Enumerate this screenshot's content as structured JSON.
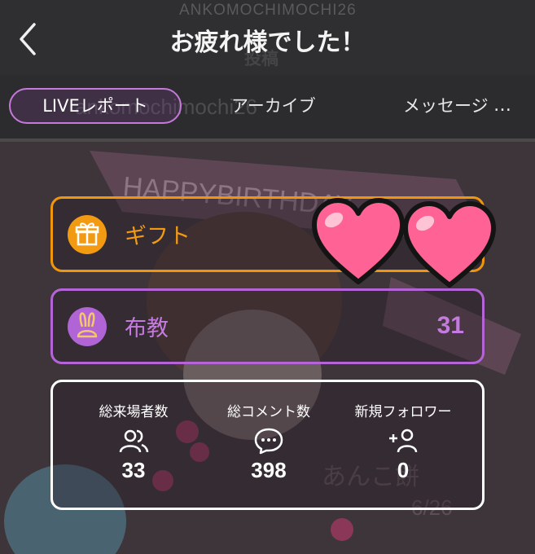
{
  "header": {
    "title": "お疲れ様でした！",
    "ghost_name": "ANKOMOCHIMOCHI26",
    "ghost_subtitle": "投稿",
    "back_icon": "chevron-left-icon"
  },
  "tabs": {
    "items": [
      {
        "label": "LIVEレポート",
        "active": true
      },
      {
        "label": "アーカイブ",
        "active": false
      },
      {
        "label": "メッセージ",
        "active": false
      }
    ],
    "more_label": "…",
    "ghost_text": "ankomochimochi26"
  },
  "gift": {
    "label": "ギフト",
    "icon": "gift-icon",
    "color": "#f29a12"
  },
  "fukyo": {
    "label": "布教",
    "value": "31",
    "icon": "rabbit-icon",
    "color": "#b064d6"
  },
  "stats": [
    {
      "label": "総来場者数",
      "value": "33",
      "icon": "users-icon"
    },
    {
      "label": "総コメント数",
      "value": "398",
      "icon": "comment-icon"
    },
    {
      "label": "新規フォロワー",
      "value": "0",
      "icon": "add-user-icon"
    }
  ],
  "background_art": {
    "banner_text": "HAPPYBIRTHDAY",
    "signature": "あんこ餅",
    "date": "6/26"
  },
  "overlay": {
    "icon": "hearts-icon",
    "color": "#ff5f8f"
  }
}
